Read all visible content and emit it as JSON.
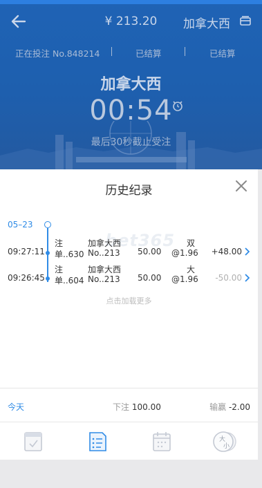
{
  "header": {
    "balance": "¥ 213.20",
    "game_name": "加拿大西",
    "status": {
      "current": "正在投注 No.848214",
      "settled_1": "已结算",
      "settled_2": "已结算"
    },
    "lottery_name": "加拿大西",
    "countdown": "00:54",
    "cutoff_notice": "最后30秒截止受注"
  },
  "history": {
    "title": "历史纪录",
    "date": "05–23",
    "records": [
      {
        "time": "09:27:11",
        "type_line1": "注",
        "type_line2": "单..630",
        "game_line1": "加拿大西",
        "game_line2": "No..213",
        "amount": "50.00",
        "option_line1": "双",
        "option_line2": "@1.96",
        "result": "+48.00"
      },
      {
        "time": "09:26:45",
        "type_line1": "注",
        "type_line2": "单..604",
        "game_line1": "加拿大西",
        "game_line2": "No..213",
        "amount": "50.00",
        "option_line1": "大",
        "option_line2": "@1.96",
        "result": "-50.00"
      }
    ],
    "load_more": "点击加载更多"
  },
  "summary": {
    "period": "今天",
    "stake_label": "下注",
    "stake_value": "100.00",
    "win_label": "输赢",
    "win_value": "-2.00"
  },
  "tabs": [
    {
      "icon": "notebook-icon"
    },
    {
      "icon": "betting-slip-icon"
    },
    {
      "icon": "calendar-icon"
    },
    {
      "icon": "big-small-coin-icon",
      "text": "大小"
    }
  ],
  "colors": {
    "accent": "#2f8be6",
    "header_blue": "#1f63b5"
  }
}
